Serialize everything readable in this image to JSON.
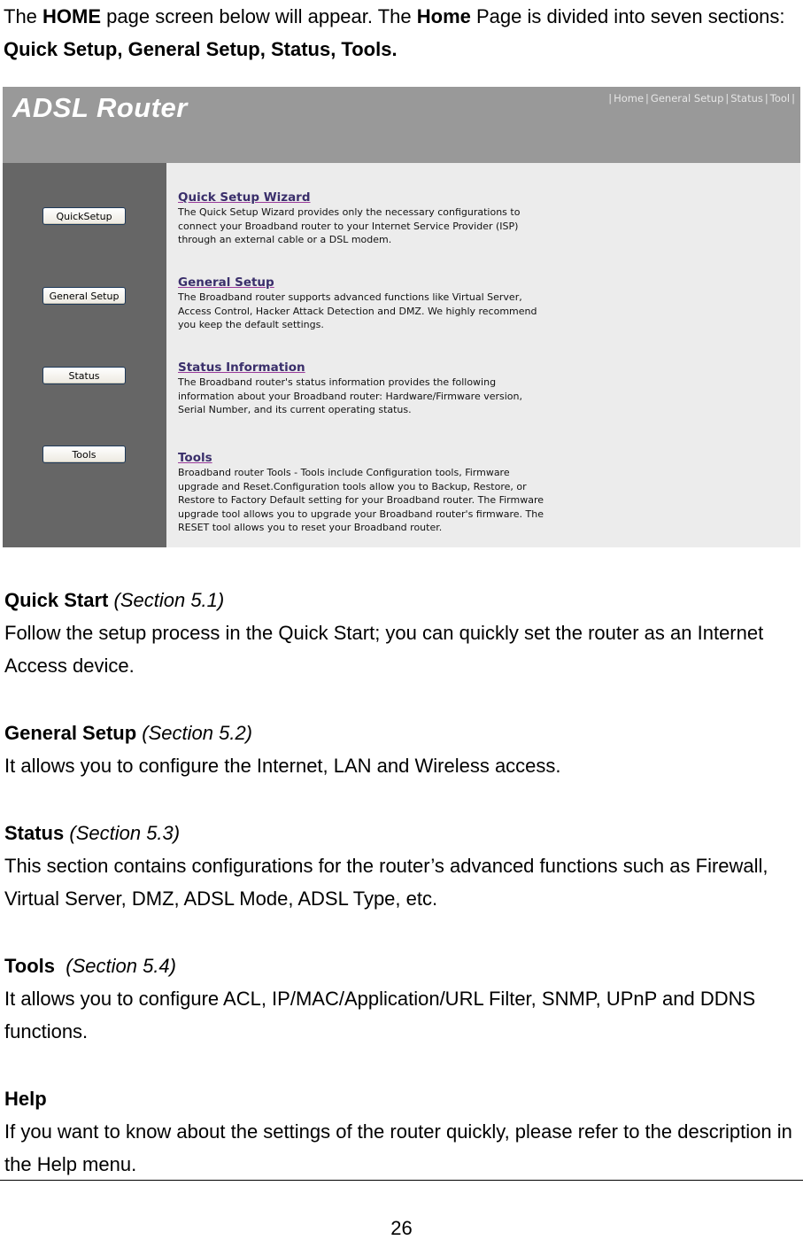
{
  "intro": {
    "p1": "The ",
    "b1": "HOME",
    "p2": " page screen below will appear. The ",
    "b2": "Home",
    "p3": " Page is divided into seven sections: ",
    "b3": "Quick Setup, General Setup, Status, Tools."
  },
  "router": {
    "title": "ADSL Router",
    "nav": [
      "Home",
      "General Setup",
      "Status",
      "Tool"
    ],
    "sidebar_buttons": [
      "QuickSetup",
      "General Setup",
      "Status",
      "Tools"
    ],
    "sections": [
      {
        "title": "Quick Setup Wizard",
        "description": "The Quick Setup Wizard provides only the necessary configurations to connect your Broadband router to your Internet Service Provider (ISP) through an external cable or a DSL modem."
      },
      {
        "title": "General Setup",
        "description": "The Broadband router supports advanced functions like Virtual Server, Access Control, Hacker Attack Detection and DMZ. We highly recommend you keep the default settings."
      },
      {
        "title": "Status Information",
        "description": "The Broadband router's status information provides the following information about your Broadband router: Hardware/Firmware version, Serial Number, and its current operating status."
      },
      {
        "title": "Tools",
        "description": "Broadband router Tools - Tools include Configuration tools, Firmware upgrade and Reset.Configuration tools allow you to Backup, Restore, or Restore to Factory Default setting for your Broadband router. The Firmware upgrade tool allows you to upgrade your Broadband router's firmware. The RESET tool allows you to reset your Broadband router."
      }
    ],
    "colors": {
      "header_bg": "#999999",
      "sidebar_bg": "#666666",
      "content_bg": "#ececec",
      "link_color": "#3a2f6b"
    }
  },
  "doc_sections": [
    {
      "heading": "Quick Start",
      "section_ref": "(Section 5.1)",
      "body": "Follow the setup process in the Quick Start; you can quickly set the router as an Internet Access device."
    },
    {
      "heading": "General Setup",
      "section_ref": "(Section 5.2)",
      "body": "It allows you to configure the Internet, LAN and Wireless access."
    },
    {
      "heading": "Status",
      "section_ref": "(Section 5.3)",
      "body": "This section contains configurations for the router’s advanced functions such as Firewall, Virtual Server, DMZ, ADSL Mode, ADSL Type, etc."
    },
    {
      "heading": "Tools",
      "section_ref": " (Section 5.4)",
      "body": "It allows you to configure ACL, IP/MAC/Application/URL Filter, SNMP, UPnP and DDNS functions."
    },
    {
      "heading": "Help",
      "section_ref": "",
      "body": "If you want to know about the settings of the router quickly, please refer to the description in the Help menu."
    }
  ],
  "page_number": "26"
}
